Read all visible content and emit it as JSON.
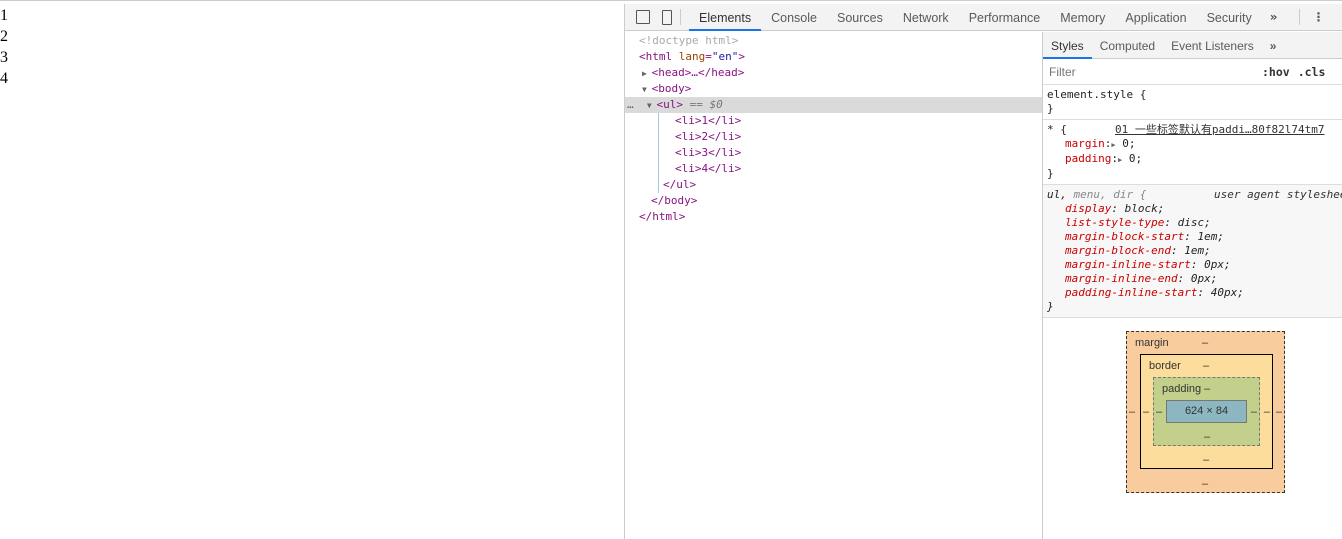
{
  "page": {
    "items": [
      "1",
      "2",
      "3",
      "4"
    ]
  },
  "toolbar": {
    "tabs": [
      "Elements",
      "Console",
      "Sources",
      "Network",
      "Performance",
      "Memory",
      "Application",
      "Security"
    ],
    "active": "Elements",
    "more": "»",
    "menu": "⋮"
  },
  "dom": {
    "doctype": "<!doctype html>",
    "html_open": "<html",
    "lang_attr": "lang",
    "lang_val": "\"en\"",
    "head": "<head>…</head>",
    "body_open": "<body>",
    "ul_open": "<ul>",
    "selected_marker": "== $0",
    "li": [
      "<li>1</li>",
      "<li>2</li>",
      "<li>3</li>",
      "<li>4</li>"
    ],
    "ul_close": "</ul>",
    "body_close": "</body>",
    "html_close": "</html>"
  },
  "styles": {
    "tabs": [
      "Styles",
      "Computed",
      "Event Listeners"
    ],
    "more": "»",
    "filter_placeholder": "Filter",
    "hov": ":hov",
    "cls": ".cls",
    "element_style": "element.style {",
    "close": "}",
    "universal": {
      "selector": "* {",
      "source": "01 一些标签默认有paddi…80f82l74tm7",
      "props": [
        [
          "margin",
          "0"
        ],
        [
          "padding",
          "0"
        ]
      ]
    },
    "ua": {
      "selector_main": "ul,",
      "selector_rest": " menu, dir {",
      "source": "user agent stylesheet",
      "props": [
        [
          "display",
          "block"
        ],
        [
          "list-style-type",
          "disc"
        ],
        [
          "margin-block-start",
          "1em"
        ],
        [
          "margin-block-end",
          "1em"
        ],
        [
          "margin-inline-start",
          "0px"
        ],
        [
          "margin-inline-end",
          "0px"
        ],
        [
          "padding-inline-start",
          "40px"
        ]
      ]
    }
  },
  "box_model": {
    "margin": "margin",
    "border": "border",
    "padding": "padding",
    "content": "624 × 84",
    "dash": "–"
  },
  "colors": {
    "accent": "#1a73e8",
    "margin": "#f9cc9d",
    "border": "#fddd9b",
    "padding": "#c3d08b",
    "content": "#8cb6c0"
  }
}
